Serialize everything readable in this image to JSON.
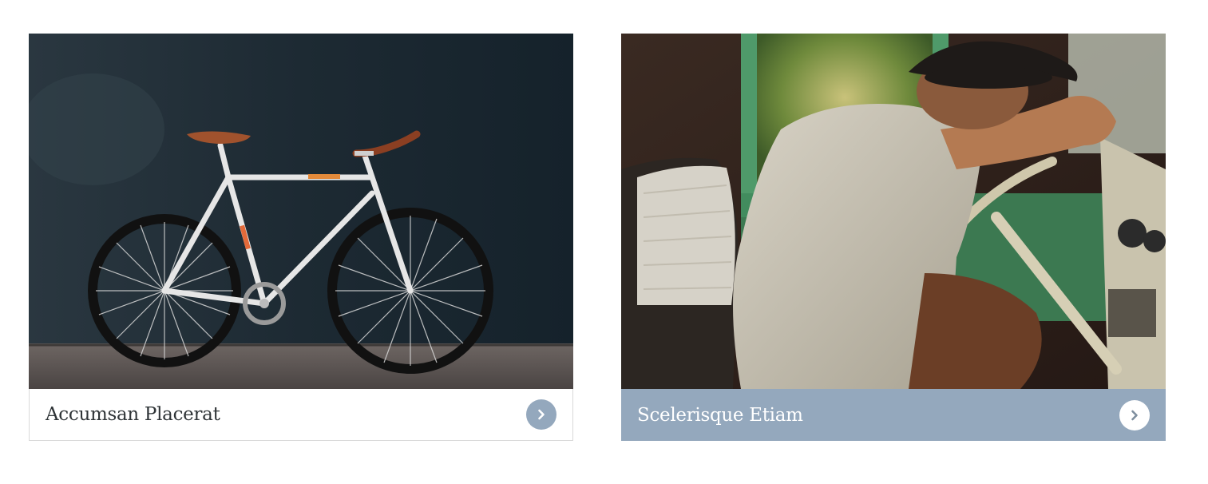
{
  "cards": [
    {
      "title": "Accumsan Placerat",
      "image_subject": "bicycle-photo",
      "arrow_icon": "chevron-right-icon",
      "footer_color": "#ffffff",
      "button_color": "#94a8bd"
    },
    {
      "title": "Scelerisque Etiam",
      "image_subject": "man-in-van-photo",
      "arrow_icon": "chevron-right-icon",
      "footer_color": "#94a8bd",
      "button_color": "#ffffff"
    }
  ]
}
